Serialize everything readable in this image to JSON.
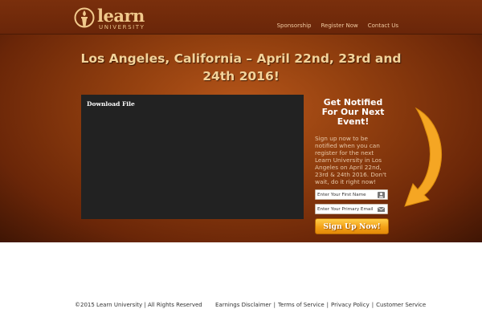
{
  "header": {
    "logo_word": "learn",
    "logo_sub": "UNIVERSITY",
    "nav": [
      "Sponsorship",
      "Register Now",
      "Contact Us"
    ]
  },
  "hero": {
    "title": "Los Angeles, California – April 22nd, 23rd and 24th 2016!",
    "video_label": "Download File"
  },
  "signup": {
    "title": "Get Notified For Our Next Event!",
    "text": "Sign up now to be notified when you can register for the next Learn University in Los Angeles on April 22nd, 23rd & 24th 2016. Don't wait, do it right now!",
    "first_name_placeholder": "Enter Your First Name",
    "email_placeholder": "Enter Your Primary Email",
    "button_label": "Sign Up Now!"
  },
  "footer": {
    "copyright": "©2015 Learn University | All Rights Reserved",
    "links": [
      "Earnings Disclaimer",
      "Terms of Service",
      "Privacy Policy",
      "Customer Service"
    ],
    "separator": "|"
  },
  "colors": {
    "header_bg": "#7a2f0c",
    "hero_glow": "#b6561a",
    "title_text": "#f3d39a",
    "button": "#f3a117",
    "arrow": "#f5a623"
  },
  "icons": {
    "logo": "torch-icon",
    "first_name_field": "person-icon",
    "email_field": "envelope-icon",
    "pointer": "curved-arrow-icon"
  }
}
